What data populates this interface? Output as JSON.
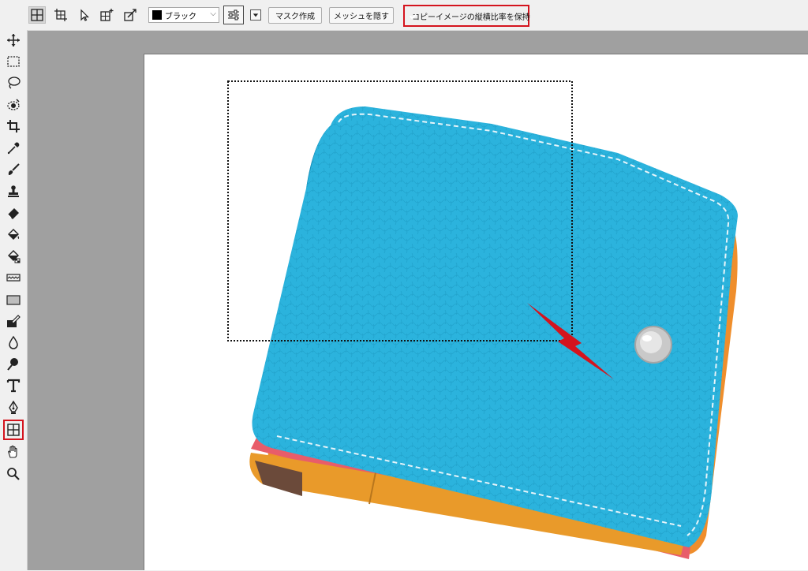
{
  "options_bar": {
    "color_label": "ブラック",
    "mask_button": "マスク作成",
    "hide_mesh_button": "メッシュを隠す",
    "keep_ratio_label": "コピーイメージの縦横比率を保持",
    "keep_ratio_checked": true,
    "icons": [
      "mesh-warp-icon",
      "perspective-warp-icon",
      "direct-select-icon",
      "add-point-icon",
      "transform-icon"
    ]
  },
  "toolbox": {
    "tools": [
      "move-icon",
      "rect-select-icon",
      "lasso-icon",
      "magic-select-icon",
      "crop-icon",
      "eyedropper-icon",
      "brush-icon",
      "stamp-icon",
      "eraser-icon",
      "fill-icon",
      "fill-pattern-icon",
      "wave-icon",
      "rectangle-shape-icon",
      "edit-icon",
      "drop-icon",
      "dodge-icon",
      "text-icon",
      "pen-icon",
      "mesh-icon",
      "hand-icon",
      "zoom-icon"
    ],
    "selected": "mesh-icon"
  },
  "colors": {
    "accent_red": "#d4141e",
    "wallet_blue": "#2bb3dd",
    "wallet_orange": "#e99a2a",
    "checkbox_blue": "#1e6fd9"
  }
}
